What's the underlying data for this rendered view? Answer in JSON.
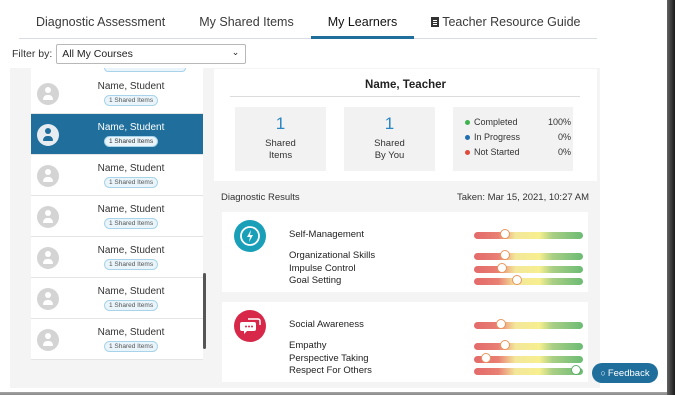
{
  "tabs": [
    {
      "label": "Diagnostic Assessment"
    },
    {
      "label": "My Shared Items"
    },
    {
      "label": "My Learners"
    },
    {
      "label": "Teacher Resource Guide",
      "icon": "document-icon"
    }
  ],
  "active_tab": "My Learners",
  "filter": {
    "label": "Filter by:",
    "value": "All My Courses",
    "icon": "chevron-down-icon"
  },
  "students": [
    {
      "name": "Name, Student",
      "badge": "1 Shared Items"
    },
    {
      "name": "Name, Student",
      "badge": "1 Shared Items",
      "selected": true
    },
    {
      "name": "Name, Student",
      "badge": "1 Shared Items"
    },
    {
      "name": "Name, Student",
      "badge": "1 Shared Items"
    },
    {
      "name": "Name, Student",
      "badge": "1 Shared Items"
    },
    {
      "name": "Name, Student",
      "badge": "1 Shared Items"
    },
    {
      "name": "Name, Student",
      "badge": "1 Shared Items"
    }
  ],
  "summary": {
    "teacher_name": "Name, Teacher",
    "shared_items": {
      "value": "1",
      "label_line1": "Shared",
      "label_line2": "Items"
    },
    "shared_by_you": {
      "value": "1",
      "label_line1": "Shared",
      "label_line2": "By You"
    },
    "statuses": [
      {
        "label": "Completed",
        "value": "100%",
        "color": "#3fb34f"
      },
      {
        "label": "In Progress",
        "value": "0%",
        "color": "#1f6eb0"
      },
      {
        "label": "Not Started",
        "value": "0%",
        "color": "#e04a3b"
      }
    ]
  },
  "diagnostic": {
    "title": "Diagnostic Results",
    "taken": "Taken: Mar 15, 2021, 10:27 AM"
  },
  "cards": [
    {
      "icon": "lightning-clock-icon",
      "icon_color": "#1a9fb8",
      "main": {
        "label": "Self-Management",
        "level": 0.28
      },
      "subs": [
        {
          "label": "Organizational Skills",
          "level": 0.28
        },
        {
          "label": "Impulse Control",
          "level": 0.26
        },
        {
          "label": "Goal Setting",
          "level": 0.39
        }
      ]
    },
    {
      "icon": "speech-bubbles-icon",
      "icon_color": "#d8284a",
      "main": {
        "label": "Social Awareness",
        "level": 0.25
      },
      "subs": [
        {
          "label": "Empathy",
          "level": 0.28
        },
        {
          "label": "Perspective Taking",
          "level": 0.11
        },
        {
          "label": "Respect For Others",
          "level": 0.94
        }
      ]
    }
  ],
  "feedback": {
    "label": "Feedback",
    "icon": "chat-icon"
  },
  "colors": {
    "accent": "#1f6e9c",
    "number": "#2a87c2"
  }
}
